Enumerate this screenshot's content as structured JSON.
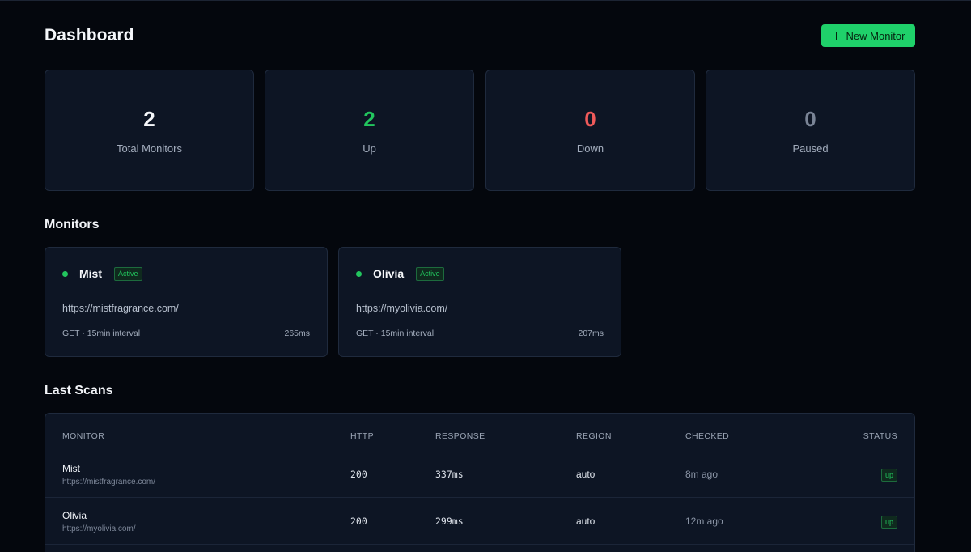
{
  "header": {
    "title": "Dashboard",
    "new_monitor_label": "New Monitor"
  },
  "stats": [
    {
      "value": "2",
      "label": "Total Monitors",
      "color": "#f5f7fa"
    },
    {
      "value": "2",
      "label": "Up",
      "color": "#22c55e"
    },
    {
      "value": "0",
      "label": "Down",
      "color": "#ef5a5a"
    },
    {
      "value": "0",
      "label": "Paused",
      "color": "#7a8496"
    }
  ],
  "monitors": {
    "title": "Monitors",
    "items": [
      {
        "name": "Mist",
        "status": "Active",
        "url": "https://mistfragrance.com/",
        "meta": "GET · 15min interval",
        "response": "265ms"
      },
      {
        "name": "Olivia",
        "status": "Active",
        "url": "https://myolivia.com/",
        "meta": "GET · 15min interval",
        "response": "207ms"
      }
    ]
  },
  "scans": {
    "title": "Last Scans",
    "columns": [
      "MONITOR",
      "HTTP",
      "RESPONSE",
      "REGION",
      "CHECKED",
      "STATUS"
    ],
    "rows": [
      {
        "name": "Mist",
        "url": "https://mistfragrance.com/",
        "http": "200",
        "response": "337ms",
        "region": "auto",
        "checked": "8m ago",
        "status": "up"
      },
      {
        "name": "Olivia",
        "url": "https://myolivia.com/",
        "http": "200",
        "response": "299ms",
        "region": "auto",
        "checked": "12m ago",
        "status": "up"
      }
    ]
  },
  "colors": {
    "accent": "#1fd16a",
    "up": "#22c55e",
    "down": "#ef5a5a",
    "background": "#04070d",
    "card": "#0d1524"
  }
}
